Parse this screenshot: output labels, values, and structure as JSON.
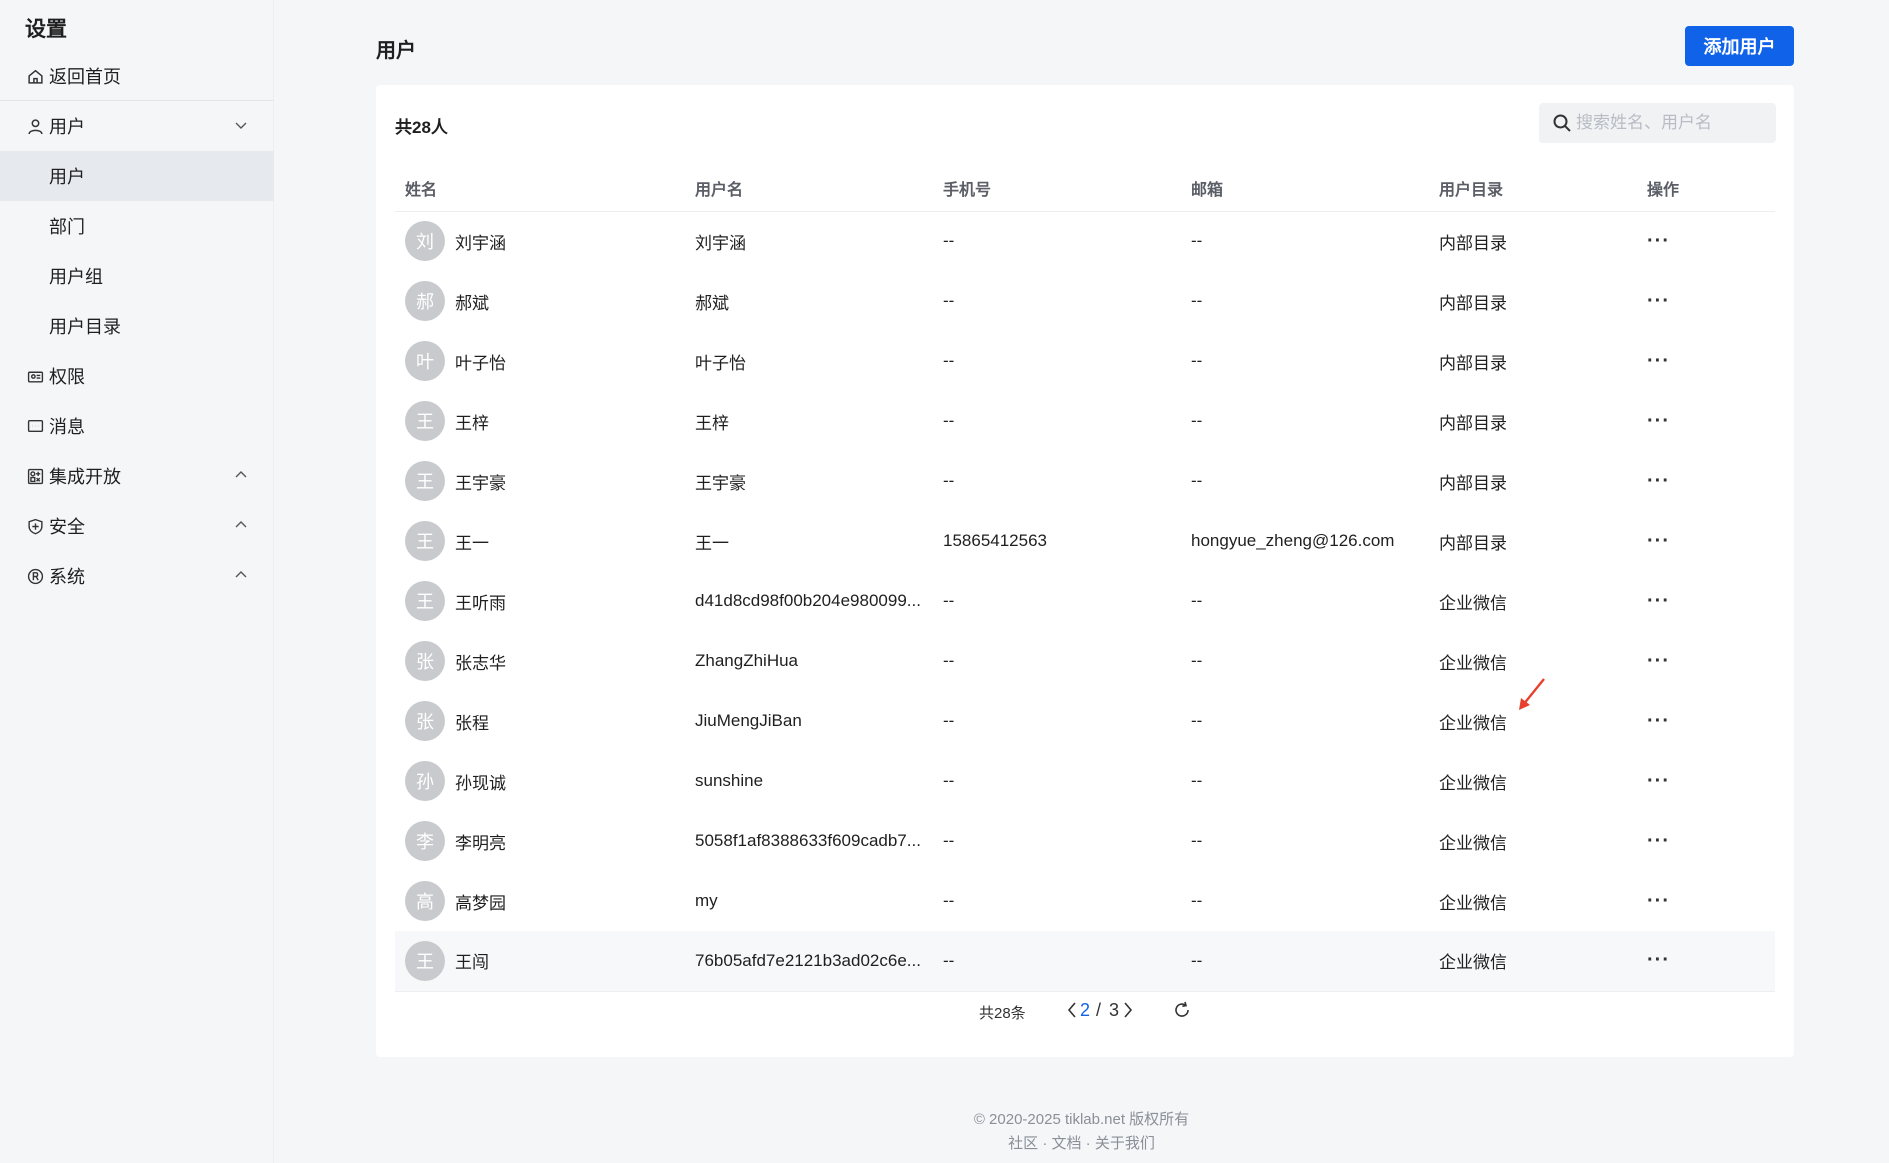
{
  "sidebar": {
    "title": "设置",
    "home": "返回首页",
    "users_group": "用户",
    "sub_items": [
      "用户",
      "部门",
      "用户组",
      "用户目录"
    ],
    "permissions": "权限",
    "messages": "消息",
    "integration": "集成开放",
    "security": "安全",
    "system": "系统"
  },
  "header": {
    "title": "用户",
    "add_button": "添加用户"
  },
  "toolbar": {
    "count_label": "共28人",
    "search_placeholder": "搜索姓名、用户名"
  },
  "table": {
    "columns": [
      "姓名",
      "用户名",
      "手机号",
      "邮箱",
      "用户目录",
      "操作"
    ],
    "rows": [
      {
        "initial": "刘",
        "name": "刘宇涵",
        "username": "刘宇涵",
        "phone": "--",
        "email": "--",
        "directory": "内部目录",
        "action": "···"
      },
      {
        "initial": "郝",
        "name": "郝斌",
        "username": "郝斌",
        "phone": "--",
        "email": "--",
        "directory": "内部目录",
        "action": "···"
      },
      {
        "initial": "叶",
        "name": "叶子怡",
        "username": "叶子怡",
        "phone": "--",
        "email": "--",
        "directory": "内部目录",
        "action": "···"
      },
      {
        "initial": "王",
        "name": "王梓",
        "username": "王梓",
        "phone": "--",
        "email": "--",
        "directory": "内部目录",
        "action": "···"
      },
      {
        "initial": "王",
        "name": "王宇豪",
        "username": "王宇豪",
        "phone": "--",
        "email": "--",
        "directory": "内部目录",
        "action": "···"
      },
      {
        "initial": "王",
        "name": "王一",
        "username": "王一",
        "phone": "15865412563",
        "email": "hongyue_zheng@126.com",
        "directory": "内部目录",
        "action": "···"
      },
      {
        "initial": "王",
        "name": "王听雨",
        "username": "d41d8cd98f00b204e980099...",
        "phone": "--",
        "email": "--",
        "directory": "企业微信",
        "action": "···"
      },
      {
        "initial": "张",
        "name": "张志华",
        "username": "ZhangZhiHua",
        "phone": "--",
        "email": "--",
        "directory": "企业微信",
        "action": "···"
      },
      {
        "initial": "张",
        "name": "张程",
        "username": "JiuMengJiBan",
        "phone": "--",
        "email": "--",
        "directory": "企业微信",
        "action": "···"
      },
      {
        "initial": "孙",
        "name": "孙现诚",
        "username": "sunshine",
        "phone": "--",
        "email": "--",
        "directory": "企业微信",
        "action": "···"
      },
      {
        "initial": "李",
        "name": "李明亮",
        "username": "5058f1af8388633f609cadb7...",
        "phone": "--",
        "email": "--",
        "directory": "企业微信",
        "action": "···"
      },
      {
        "initial": "高",
        "name": "高梦园",
        "username": "my",
        "phone": "--",
        "email": "--",
        "directory": "企业微信",
        "action": "···"
      },
      {
        "initial": "王",
        "name": "王闯",
        "username": "76b05afd7e2121b3ad02c6e...",
        "phone": "--",
        "email": "--",
        "directory": "企业微信",
        "action": "···"
      }
    ]
  },
  "pagination": {
    "total": "共28条",
    "current": "2",
    "separator": "/",
    "pages": "3"
  },
  "footer": {
    "copyright": "© 2020-2025 tiklab.net 版权所有",
    "community": "社区",
    "docs": "文档",
    "about": "关于我们",
    "dot": "·"
  },
  "colors": {
    "accent": "#1063e8",
    "annotation_arrow": "#e8402e"
  }
}
